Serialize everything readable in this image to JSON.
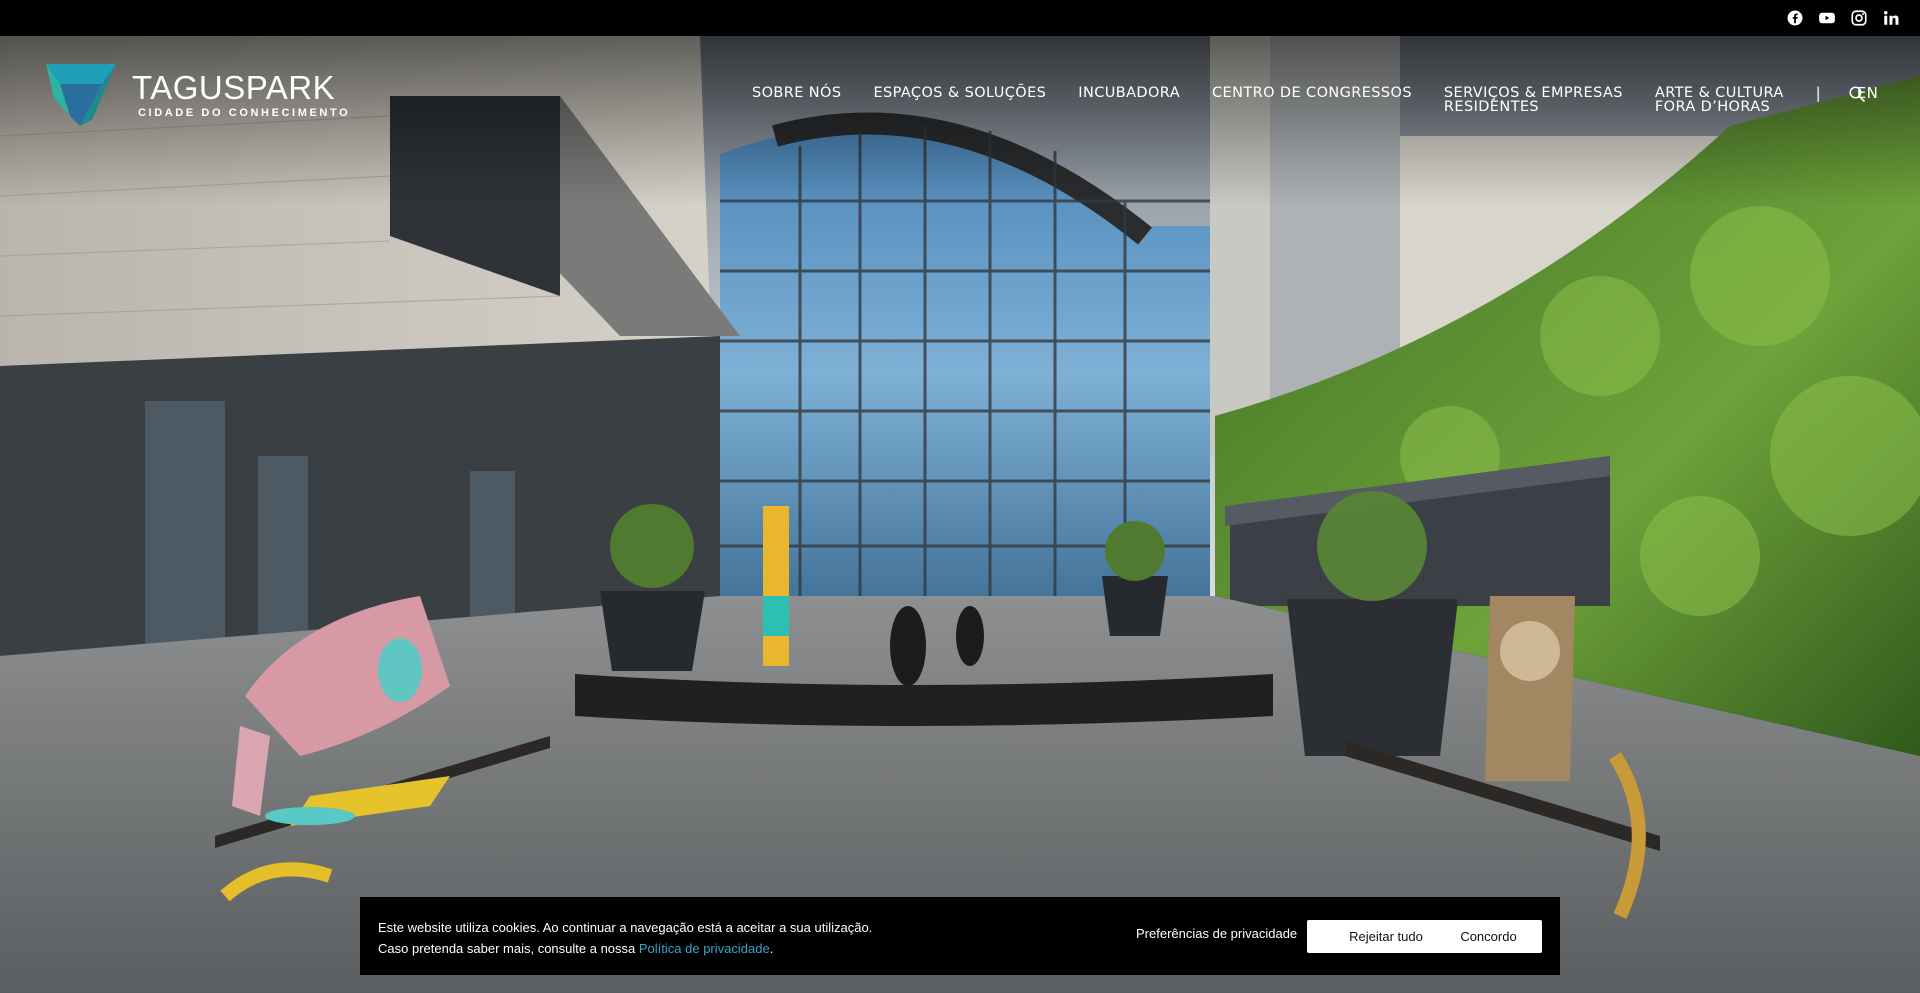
{
  "social": [
    {
      "name": "facebook-icon"
    },
    {
      "name": "youtube-icon"
    },
    {
      "name": "instagram-icon"
    },
    {
      "name": "linkedin-icon"
    }
  ],
  "logo": {
    "name": "TAGUSPARK",
    "tagline": "CIDADE DO CONHECIMENTO",
    "colors": [
      "#1e9fb5",
      "#2bb3a3",
      "#2a6ea0"
    ]
  },
  "nav": {
    "items": [
      {
        "label": "SOBRE NÓS"
      },
      {
        "label": "ESPAÇOS & SOLUÇÕES"
      },
      {
        "label": "INCUBADORA"
      },
      {
        "label": "CENTRO DE CONGRESSOS"
      },
      {
        "label": "SERVIÇOS & EMPRESAS\nRESIDENTES"
      },
      {
        "label": "ARTE & CULTURA\nFORA D’HORAS"
      }
    ],
    "separator": "|",
    "language": "EN",
    "search_icon": "search-icon"
  },
  "cookie": {
    "line1": "Este website utiliza cookies. Ao continuar a navegação está a aceitar a sua utilização.",
    "line2_prefix": "Caso pretenda saber mais, consulte a nossa ",
    "policy_link": "Política de privacidade",
    "line2_suffix": ".",
    "preferences": "Preferências de privacidade",
    "reject": "Rejeitar tudo",
    "accept": "Concordo"
  },
  "colors": {
    "topbar": "#000000",
    "link": "#3aa3c7"
  }
}
